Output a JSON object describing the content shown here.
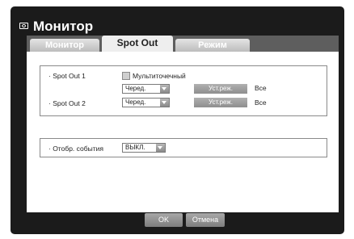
{
  "window": {
    "title": "Монитор"
  },
  "tabs": [
    {
      "label": "Монитор",
      "active": false
    },
    {
      "label": "Spot Out",
      "active": true
    },
    {
      "label": "Режим",
      "active": false
    }
  ],
  "spot_out_group": {
    "spot_out_1": {
      "label": "· Spot Out 1",
      "multipoint_label": "Мультиточечный",
      "multipoint_checked": false,
      "select_value": "Черед.",
      "mode_button": "Уст.реж.",
      "mode_value": "Все"
    },
    "spot_out_2": {
      "label": "· Spot Out 2",
      "select_value": "Черед.",
      "mode_button": "Уст.реж.",
      "mode_value": "Все"
    }
  },
  "event_group": {
    "label": "· Отобр. события",
    "select_value": "ВЫКЛ."
  },
  "footer": {
    "ok": "OK",
    "cancel": "Отмена"
  },
  "colors": {
    "frame": "#1b1b1b",
    "tab_bar": "#5e5e5e",
    "active_tab": "#eeeeee",
    "button": "#9a9a9a"
  }
}
